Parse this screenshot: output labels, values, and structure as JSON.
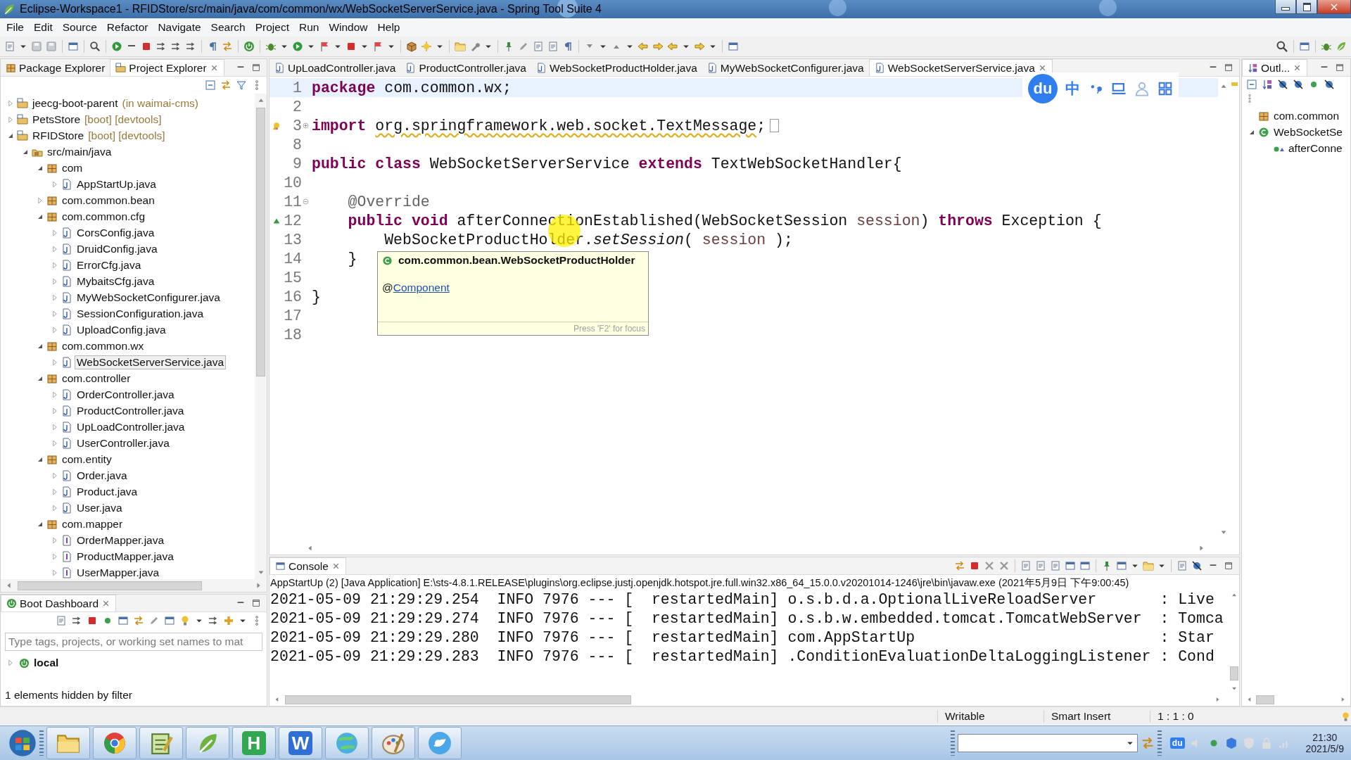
{
  "window": {
    "title": "Eclipse-Workspace1 - RFIDStore/src/main/java/com/common/wx/WebSocketServerService.java - Spring Tool Suite 4"
  },
  "menu": [
    "File",
    "Edit",
    "Source",
    "Refactor",
    "Navigate",
    "Search",
    "Project",
    "Run",
    "Window",
    "Help"
  ],
  "left_panel": {
    "tabs": [
      {
        "label": "Package Explorer",
        "selected": false
      },
      {
        "label": "Project Explorer",
        "selected": true
      }
    ],
    "tree": [
      {
        "label": "jeecg-boot-parent",
        "decoration": "(in waimai-cms)",
        "kind": "project",
        "expanded": false,
        "selected": false
      },
      {
        "label": "PetsStore",
        "decoration": "[boot] [devtools]",
        "kind": "project",
        "expanded": false,
        "selected": false
      },
      {
        "label": "RFIDStore",
        "decoration": "[boot] [devtools]",
        "kind": "project",
        "expanded": true,
        "selected": false,
        "children": [
          {
            "label": "src/main/java",
            "kind": "source-folder",
            "expanded": true,
            "selected": false,
            "children": [
              {
                "label": "com",
                "kind": "package",
                "expanded": true,
                "selected": false,
                "children": [
                  {
                    "label": "AppStartUp.java",
                    "kind": "class",
                    "expanded": false,
                    "selected": false
                  }
                ]
              },
              {
                "label": "com.common.bean",
                "kind": "package",
                "expanded": false,
                "selected": false
              },
              {
                "label": "com.common.cfg",
                "kind": "package",
                "expanded": true,
                "selected": false,
                "children": [
                  {
                    "label": "CorsConfig.java",
                    "kind": "class",
                    "expanded": false,
                    "selected": false
                  },
                  {
                    "label": "DruidConfig.java",
                    "kind": "class",
                    "expanded": false,
                    "selected": false
                  },
                  {
                    "label": "ErrorCfg.java",
                    "kind": "class",
                    "expanded": false,
                    "selected": false
                  },
                  {
                    "label": "MybaitsCfg.java",
                    "kind": "class",
                    "expanded": false,
                    "selected": false
                  },
                  {
                    "label": "MyWebSocketConfigurer.java",
                    "kind": "class",
                    "expanded": false,
                    "selected": false
                  },
                  {
                    "label": "SessionConfiguration.java",
                    "kind": "class",
                    "expanded": false,
                    "selected": false
                  },
                  {
                    "label": "UploadConfig.java",
                    "kind": "class",
                    "expanded": false,
                    "selected": false
                  }
                ]
              },
              {
                "label": "com.common.wx",
                "kind": "package",
                "expanded": true,
                "selected": false,
                "children": [
                  {
                    "label": "WebSocketServerService.java",
                    "kind": "class",
                    "expanded": false,
                    "selected": true
                  }
                ]
              },
              {
                "label": "com.controller",
                "kind": "package",
                "expanded": true,
                "selected": false,
                "children": [
                  {
                    "label": "OrderController.java",
                    "kind": "class",
                    "expanded": false,
                    "selected": false
                  },
                  {
                    "label": "ProductController.java",
                    "kind": "class",
                    "expanded": false,
                    "selected": false
                  },
                  {
                    "label": "UpLoadController.java",
                    "kind": "class",
                    "expanded": false,
                    "selected": false
                  },
                  {
                    "label": "UserController.java",
                    "kind": "class",
                    "expanded": false,
                    "selected": false
                  }
                ]
              },
              {
                "label": "com.entity",
                "kind": "package",
                "expanded": true,
                "selected": false,
                "children": [
                  {
                    "label": "Order.java",
                    "kind": "class",
                    "expanded": false,
                    "selected": false
                  },
                  {
                    "label": "Product.java",
                    "kind": "class",
                    "expanded": false,
                    "selected": false
                  },
                  {
                    "label": "User.java",
                    "kind": "class",
                    "expanded": false,
                    "selected": false
                  }
                ]
              },
              {
                "label": "com.mapper",
                "kind": "package",
                "expanded": true,
                "selected": false,
                "children": [
                  {
                    "label": "OrderMapper.java",
                    "kind": "interface",
                    "expanded": false,
                    "selected": false
                  },
                  {
                    "label": "ProductMapper.java",
                    "kind": "interface",
                    "expanded": false,
                    "selected": false
                  },
                  {
                    "label": "UserMapper.java",
                    "kind": "interface",
                    "expanded": false,
                    "selected": false
                  }
                ]
              }
            ]
          }
        ]
      }
    ]
  },
  "boot_dashboard": {
    "tab": "Boot Dashboard",
    "search": {
      "placeholder": "Type tags, projects, or working set names to mat"
    },
    "items": [
      {
        "label": "local",
        "expanded": false
      }
    ],
    "footer": "1 elements hidden by filter"
  },
  "editor": {
    "tabs": [
      {
        "label": "UpLoadController.java",
        "selected": false
      },
      {
        "label": "ProductController.java",
        "selected": false
      },
      {
        "label": "WebSocketProductHolder.java",
        "selected": false
      },
      {
        "label": "MyWebSocketConfigurer.java",
        "selected": false
      },
      {
        "label": "WebSocketServerService.java",
        "selected": true
      }
    ],
    "lines": [
      {
        "number": "1",
        "tokens": [
          {
            "kind": "keyword",
            "text": "package"
          },
          {
            "kind": "plain",
            "text": " com.common.wx;"
          }
        ]
      },
      {
        "number": "2"
      },
      {
        "number": "3",
        "fold": {
          "expanded": false
        },
        "marker": {
          "kind": "warning"
        },
        "tokens": [
          {
            "kind": "keyword",
            "text": "import "
          },
          {
            "kind": "warning",
            "text": "org.springframework.web.socket.TextMessage"
          },
          {
            "kind": "plain",
            "text": ";"
          }
        ]
      },
      {
        "number": "8"
      },
      {
        "number": "9",
        "tokens": [
          {
            "kind": "keyword",
            "text": "public"
          },
          {
            "kind": "keyword",
            "text": " class"
          },
          {
            "kind": "plain",
            "text": " WebSocketServerService "
          },
          {
            "kind": "keyword",
            "text": "extends"
          },
          {
            "kind": "plain",
            "text": " TextWebSocketHandler{"
          }
        ]
      },
      {
        "number": "10"
      },
      {
        "number": "11",
        "fold": {
          "expanded": true
        },
        "tokens": [
          {
            "kind": "annotation",
            "text": "    @Override"
          }
        ]
      },
      {
        "number": "12",
        "marker": {
          "kind": "override"
        },
        "tokens": [
          {
            "kind": "keyword",
            "text": "    public"
          },
          {
            "kind": "keyword",
            "text": " void"
          },
          {
            "kind": "plain",
            "text": " afterConnectionEstablished(WebSocketSession "
          },
          {
            "kind": "variable",
            "text": "session"
          },
          {
            "kind": "plain",
            "text": ") "
          },
          {
            "kind": "keyword",
            "text": "throws"
          },
          {
            "kind": "plain",
            "text": " Exception {"
          }
        ]
      },
      {
        "number": "13",
        "tokens": [
          {
            "kind": "plain",
            "text": "        WebSocketProductHolder."
          },
          {
            "kind": "static",
            "text": "setSession"
          },
          {
            "kind": "plain",
            "text": "( "
          },
          {
            "kind": "variable",
            "text": "session"
          },
          {
            "kind": "plain",
            "text": " );"
          }
        ]
      },
      {
        "number": "14",
        "tokens": [
          {
            "kind": "plain",
            "text": "    }"
          }
        ]
      },
      {
        "number": "15"
      },
      {
        "number": "16",
        "tokens": [
          {
            "kind": "plain",
            "text": "}"
          }
        ]
      },
      {
        "number": "17"
      },
      {
        "number": "18"
      }
    ],
    "hover": {
      "title": "com.common.bean.WebSocketProductHolder",
      "prefix": "@",
      "link": "Component",
      "footer": "Press 'F2' for focus"
    }
  },
  "ime_toolbar": {
    "logo": "du",
    "mode": "中"
  },
  "outline": {
    "tab": "Outl...",
    "items": [
      {
        "label": "com.common",
        "kind": "package"
      },
      {
        "label": "WebSocketSe",
        "kind": "class",
        "expanded": true,
        "children": [
          {
            "label": "afterConne",
            "kind": "method"
          }
        ]
      }
    ]
  },
  "console": {
    "tab": "Console",
    "header": "AppStartUp (2) [Java Application] E:\\sts-4.8.1.RELEASE\\plugins\\org.eclipse.justj.openjdk.hotspot.jre.full.win32.x86_64_15.0.0.v20201014-1246\\jre\\bin\\javaw.exe  (2021年5月9日 下午9:00:45)",
    "lines": [
      "2021-05-09 21:29:29.254  INFO 7976 --- [  restartedMain] o.s.b.d.a.OptionalLiveReloadServer       : Live",
      "2021-05-09 21:29:29.274  INFO 7976 --- [  restartedMain] o.s.b.w.embedded.tomcat.TomcatWebServer  : Tomca",
      "2021-05-09 21:29:29.280  INFO 7976 --- [  restartedMain] com.AppStartUp                           : Star",
      "2021-05-09 21:29:29.283  INFO 7976 --- [  restartedMain] .ConditionEvaluationDeltaLoggingListener : Cond"
    ]
  },
  "status_bar": [
    "Writable",
    "Smart Insert",
    "1 : 1 : 0"
  ],
  "taskbar": {
    "apps": [
      {
        "kind": "folder"
      },
      {
        "kind": "browser"
      },
      {
        "kind": "notepad"
      },
      {
        "kind": "leaf"
      },
      {
        "kind": "letter",
        "glyph": "H",
        "color": "#2fa84f"
      },
      {
        "kind": "letter",
        "glyph": "W",
        "color": "#2f6fd6"
      },
      {
        "kind": "globe"
      },
      {
        "kind": "paint"
      },
      {
        "kind": "bird"
      }
    ],
    "tray_ime": "du",
    "clock": {
      "time": "21:30",
      "date": "2021/5/9"
    }
  }
}
